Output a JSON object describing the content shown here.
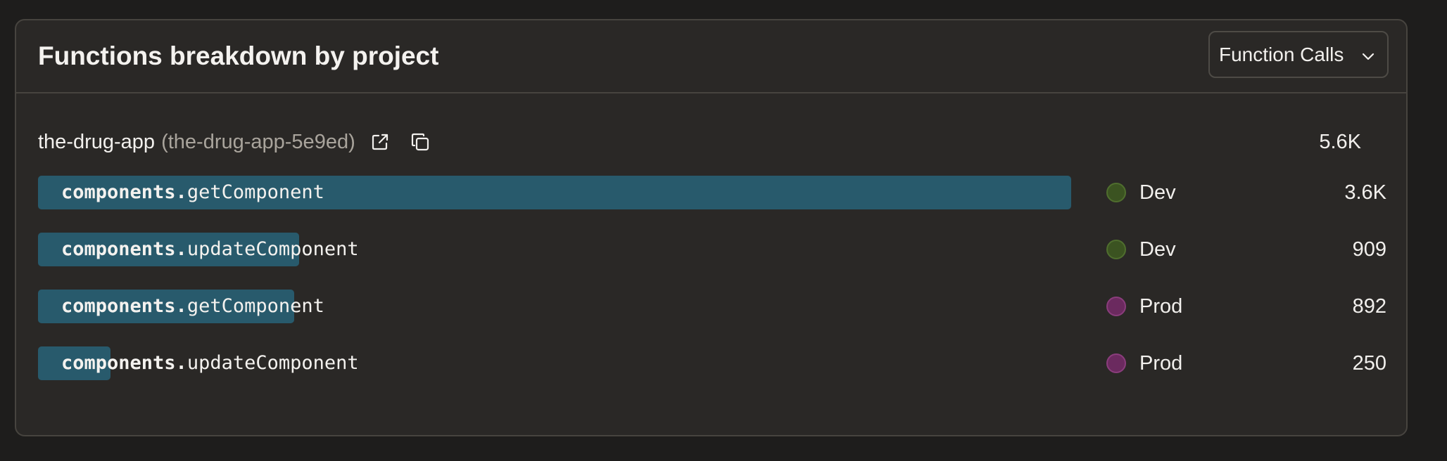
{
  "panel": {
    "title": "Functions breakdown by project",
    "metric_select": {
      "value": "Function Calls",
      "icon": "chevron-down-icon"
    }
  },
  "project": {
    "name": "the-drug-app",
    "id_text": "(the-drug-app-5e9ed)",
    "total": "5.6K",
    "open_icon": "external-link-icon",
    "copy_icon": "copy-icon"
  },
  "colors": {
    "bar": "#285a6c",
    "dev_dot": "#3b5321",
    "prod_dot": "#6b2a5f"
  },
  "functions": [
    {
      "module": "components.",
      "name": "getComponent",
      "env": "Dev",
      "count": "3.6K",
      "value": 3600,
      "fraction": 1.0
    },
    {
      "module": "components.",
      "name": "updateComponent",
      "env": "Dev",
      "count": "909",
      "value": 909,
      "fraction": 0.253
    },
    {
      "module": "components.",
      "name": "getComponent",
      "env": "Prod",
      "count": "892",
      "value": 892,
      "fraction": 0.248
    },
    {
      "module": "components.",
      "name": "updateComponent",
      "env": "Prod",
      "count": "250",
      "value": 250,
      "fraction": 0.07
    }
  ]
}
